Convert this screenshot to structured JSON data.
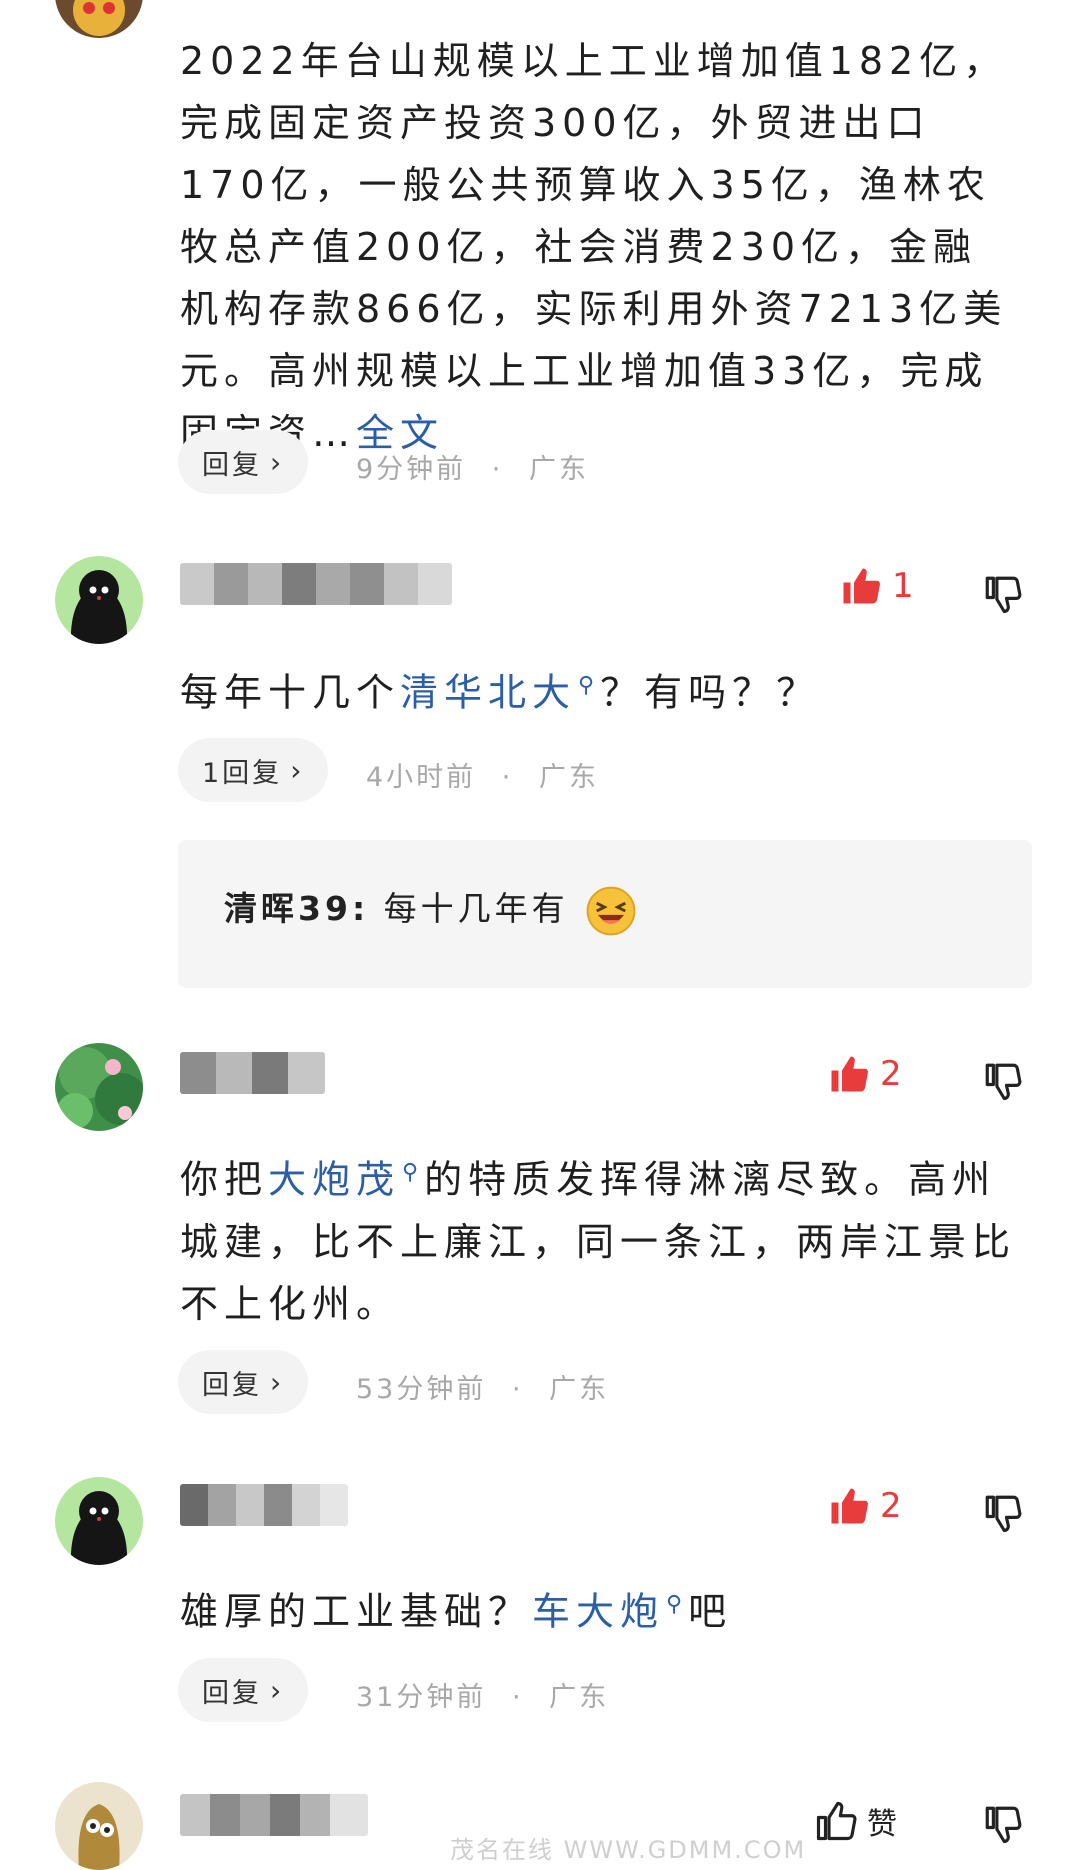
{
  "comments": [
    {
      "text": "2022年台山规模以上工业增加值182亿，完成固定资产投资300亿，外贸进出口170亿，一般公共预算收入35亿，渔林农牧总产值200亿，社会消费230亿，金融机构存款866亿，实际利用外资7213亿美元。高州规模以上工业增加值33亿，完成固定资",
      "ellipsis": "…",
      "more_link": "全文",
      "reply_label": "回复",
      "time": "9分钟前",
      "location": "广东"
    },
    {
      "likes": "1",
      "text_before": "每年十几个",
      "link": "清华北大",
      "text_after": "？有吗？？",
      "reply_label": "1回复",
      "time": "4小时前",
      "location": "广东",
      "subreply": {
        "author": "清晖39",
        "sep": ":",
        "text": "每十几年有"
      }
    },
    {
      "likes": "2",
      "text_before": "你把",
      "link": "大炮茂",
      "text_after": "的特质发挥得淋漓尽致。高州城建，比不上廉江，同一条江，两岸江景比不上化州。",
      "reply_label": "回复",
      "time": "53分钟前",
      "location": "广东"
    },
    {
      "likes": "2",
      "text_before": "雄厚的工业基础？",
      "link": "车大炮",
      "text_after": "吧",
      "reply_label": "回复",
      "time": "31分钟前",
      "location": "广东"
    },
    {
      "like_label": "赞"
    }
  ],
  "meta_separator": "·",
  "watermark": "茂名在线 WWW.GDMM.COM",
  "colors": {
    "accent_like": "#e83c3c",
    "link": "#2c5ea8",
    "meta": "#a8a8a8",
    "pill_bg": "#f3f3f3"
  }
}
